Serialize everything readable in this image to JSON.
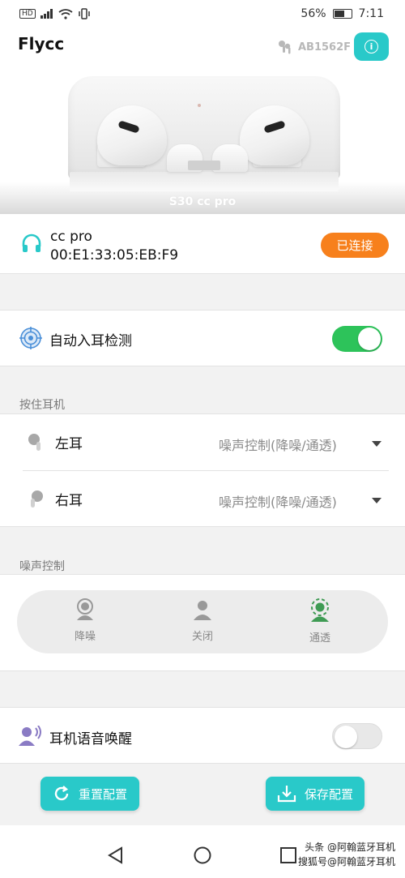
{
  "status_bar": {
    "hd": "HD",
    "battery": "56%",
    "time": "7:11"
  },
  "header": {
    "title": "Flycc",
    "device_id": "AB1562F"
  },
  "hero": {
    "model_name": "S30 cc pro"
  },
  "connection": {
    "device_name": "cc pro",
    "mac": "00:E1:33:05:EB:F9",
    "status": "已连接"
  },
  "auto_ear": {
    "label": "自动入耳检测",
    "enabled": true
  },
  "press_hold": {
    "section_label": "按住耳机",
    "left": {
      "label": "左耳",
      "value": "噪声控制(降噪/通透)"
    },
    "right": {
      "label": "右耳",
      "value": "噪声控制(降噪/通透)"
    }
  },
  "noise_control": {
    "section_label": "噪声控制",
    "options": [
      {
        "label": "降噪",
        "icon": "anc-icon"
      },
      {
        "label": "关闭",
        "icon": "person-icon"
      },
      {
        "label": "通透",
        "icon": "transparency-icon"
      }
    ],
    "selected": "通透"
  },
  "voice_wake": {
    "label": "耳机语音唤醒",
    "enabled": false
  },
  "actions": {
    "reset": "重置配置",
    "save": "保存配置"
  },
  "watermark": {
    "line1": "头条 @阿翰蓝牙耳机",
    "line2": "搜狐号@阿翰蓝牙耳机"
  },
  "colors": {
    "accent": "#29c9c9",
    "connected_badge": "#f7801c",
    "toggle_on": "#2dc35a"
  }
}
